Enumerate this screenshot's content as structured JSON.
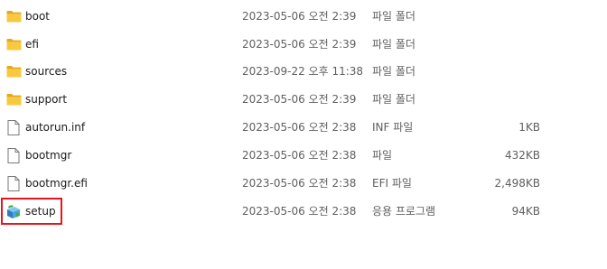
{
  "files": [
    {
      "name": "boot",
      "date": "2023-05-06 오전 2:39",
      "type": "파일 폴더",
      "size": "",
      "icon": "folder-icon"
    },
    {
      "name": "efi",
      "date": "2023-05-06 오전 2:39",
      "type": "파일 폴더",
      "size": "",
      "icon": "folder-icon"
    },
    {
      "name": "sources",
      "date": "2023-09-22 오후 11:38",
      "type": "파일 폴더",
      "size": "",
      "icon": "folder-icon"
    },
    {
      "name": "support",
      "date": "2023-05-06 오전 2:39",
      "type": "파일 폴더",
      "size": "",
      "icon": "folder-icon"
    },
    {
      "name": "autorun.inf",
      "date": "2023-05-06 오전 2:38",
      "type": "INF 파일",
      "size": "1KB",
      "icon": "file-icon"
    },
    {
      "name": "bootmgr",
      "date": "2023-05-06 오전 2:38",
      "type": "파일",
      "size": "432KB",
      "icon": "file-icon"
    },
    {
      "name": "bootmgr.efi",
      "date": "2023-05-06 오전 2:38",
      "type": "EFI 파일",
      "size": "2,498KB",
      "icon": "file-icon"
    },
    {
      "name": "setup",
      "date": "2023-05-06 오전 2:38",
      "type": "응용 프로그램",
      "size": "94KB",
      "icon": "setup-app-icon"
    }
  ],
  "colors": {
    "folder": "#f8c93f",
    "highlight": "#e8141c"
  }
}
